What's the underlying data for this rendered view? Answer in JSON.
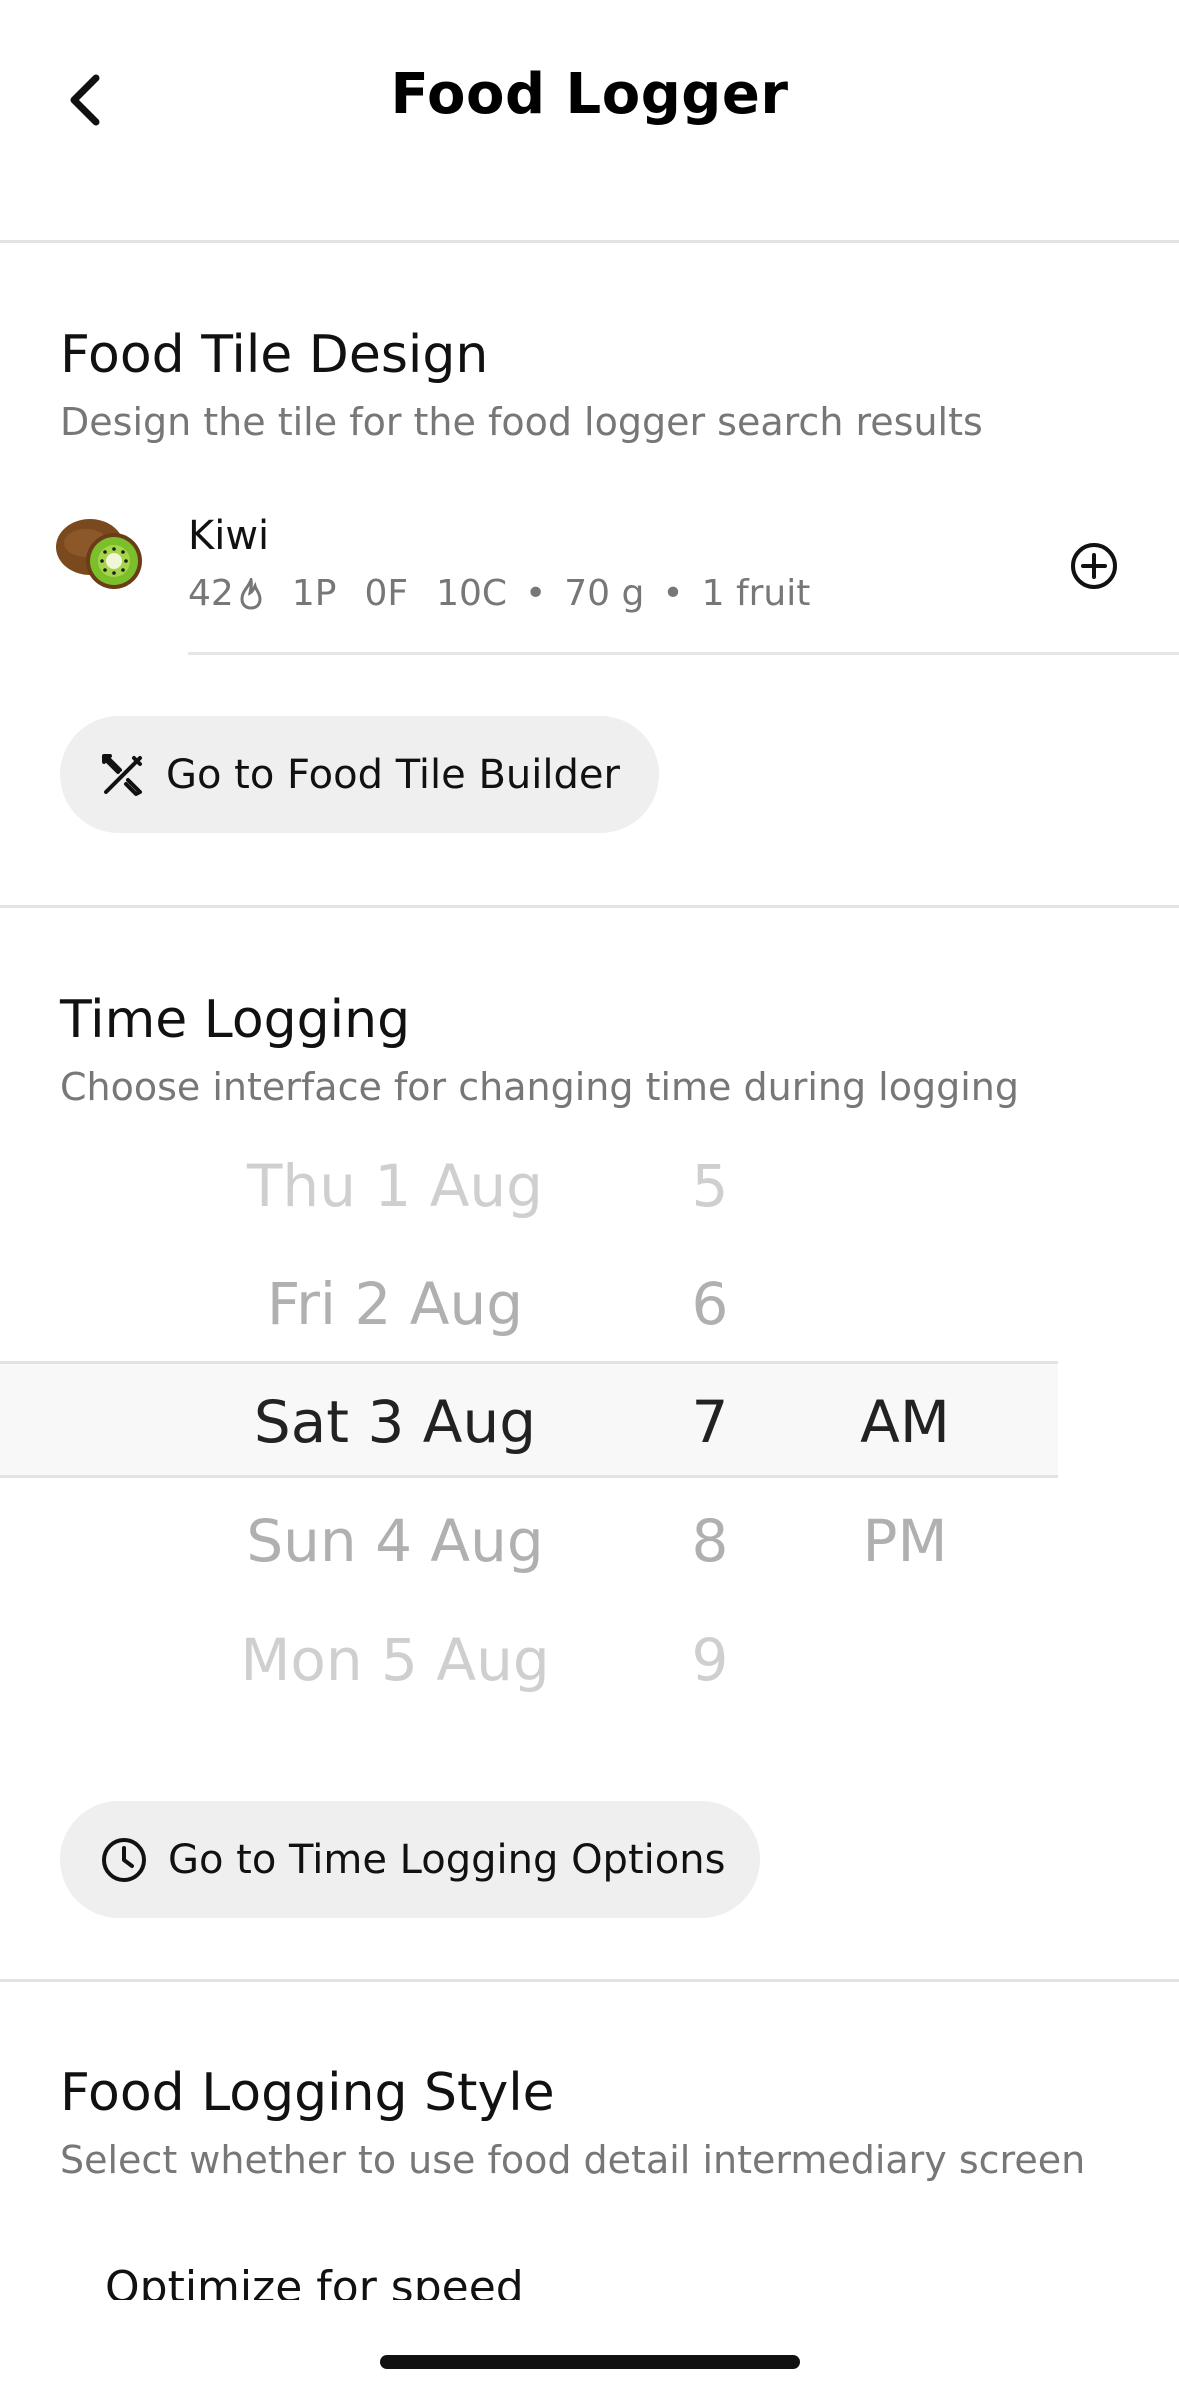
{
  "header": {
    "title": "Food Logger",
    "back_icon": "chevron-left-icon"
  },
  "food_tile_section": {
    "title": "Food Tile Design",
    "subtitle": "Design the tile for the food logger search results",
    "sample": {
      "name": "Kiwi",
      "calories": "42",
      "calorie_icon": "flame-icon",
      "protein": "1P",
      "fat": "0F",
      "carbs": "10C",
      "weight": "70 g",
      "serving": "1 fruit",
      "add_icon": "plus-circle-icon"
    },
    "button_label": "Go to Food Tile Builder",
    "button_icon": "tools-icon"
  },
  "time_logging_section": {
    "title": "Time Logging",
    "subtitle": "Choose interface for changing time during logging",
    "picker": {
      "dates": [
        "Thu 1 Aug",
        "Fri 2 Aug",
        "Sat 3 Aug",
        "Sun 4 Aug",
        "Mon 5 Aug"
      ],
      "hours": [
        "5",
        "6",
        "7",
        "8",
        "9"
      ],
      "periods": [
        "AM",
        "PM"
      ],
      "selected_date": "Sat 3 Aug",
      "selected_hour": "7",
      "selected_period": "AM"
    },
    "button_label": "Go to Time Logging Options",
    "button_icon": "clock-icon"
  },
  "food_logging_style_section": {
    "title": "Food Logging Style",
    "subtitle": "Select whether to use food detail intermediary screen",
    "option_partial": "Optimize for speed"
  }
}
